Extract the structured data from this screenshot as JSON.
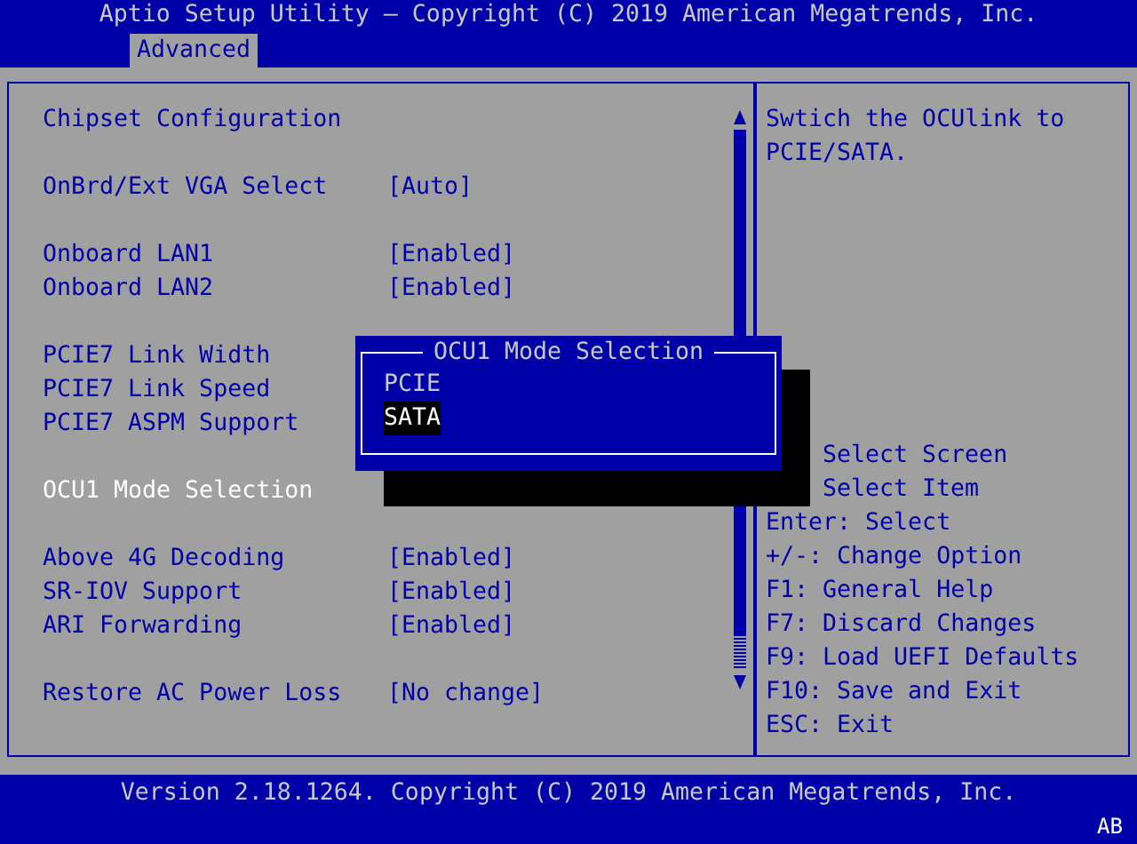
{
  "title": "Aptio Setup Utility – Copyright (C) 2019 American Megatrends, Inc.",
  "tabs": [
    {
      "label": "Advanced",
      "selected": true
    }
  ],
  "settings": [
    {
      "kind": "heading",
      "label": "Chipset Configuration"
    },
    {
      "kind": "gap"
    },
    {
      "kind": "option",
      "label": "OnBrd/Ext VGA Select",
      "value": "[Auto]",
      "selected": false
    },
    {
      "kind": "gap"
    },
    {
      "kind": "option",
      "label": "Onboard LAN1",
      "value": "[Enabled]",
      "selected": false
    },
    {
      "kind": "option",
      "label": "Onboard LAN2",
      "value": "[Enabled]",
      "selected": false
    },
    {
      "kind": "gap"
    },
    {
      "kind": "option",
      "label": "PCIE7 Link Width",
      "selected": false
    },
    {
      "kind": "option",
      "label": "PCIE7 Link Speed",
      "selected": false
    },
    {
      "kind": "option",
      "label": "PCIE7 ASPM Support",
      "selected": false
    },
    {
      "kind": "gap"
    },
    {
      "kind": "option",
      "label": "OCU1 Mode Selection",
      "selected": true
    },
    {
      "kind": "gap"
    },
    {
      "kind": "option",
      "label": "Above 4G Decoding",
      "value": "[Enabled]",
      "selected": false
    },
    {
      "kind": "option",
      "label": "SR-IOV Support",
      "value": "[Enabled]",
      "selected": false
    },
    {
      "kind": "option",
      "label": "ARI Forwarding",
      "value": "[Enabled]",
      "selected": false
    },
    {
      "kind": "gap"
    },
    {
      "kind": "option",
      "label": "Restore AC Power Loss",
      "value": "[No change]",
      "selected": false
    }
  ],
  "help_text": "Swtich the OCUlink to PCIE/SATA.",
  "key_help": [
    {
      "text": "Select Screen",
      "obscured": true
    },
    {
      "text": "Select Item",
      "obscured": true
    },
    {
      "text": "Enter: Select",
      "obscured": false
    },
    {
      "text": "+/-: Change Option",
      "obscured": false
    },
    {
      "text": "F1: General Help",
      "obscured": false
    },
    {
      "text": "F7: Discard Changes",
      "obscured": false
    },
    {
      "text": "F9: Load UEFI Defaults",
      "obscured": false
    },
    {
      "text": "F10: Save and Exit",
      "obscured": false
    },
    {
      "text": "ESC: Exit",
      "obscured": false
    }
  ],
  "popup": {
    "title": "OCU1 Mode Selection",
    "options": [
      {
        "label": "PCIE",
        "selected": false
      },
      {
        "label": "SATA",
        "selected": true
      }
    ]
  },
  "footer": "Version 2.18.1264. Copyright (C) 2019 American Megatrends, Inc.",
  "indicator": "AB"
}
